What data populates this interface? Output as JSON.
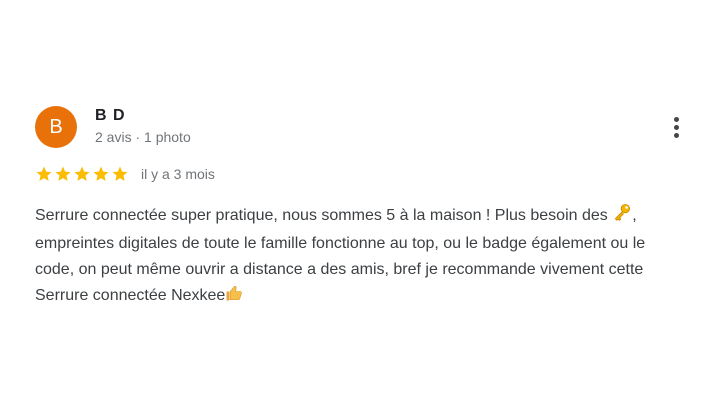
{
  "author": {
    "initial": "B",
    "name": "B D",
    "meta": "2 avis · 1 photo",
    "avatar_color": "#e8710a"
  },
  "rating": {
    "stars": 5,
    "max": 5,
    "date": "il y a 3 mois",
    "star_color": "#fbbc04"
  },
  "review": {
    "part1": "Serrure connectée super pratique, nous sommes 5 à la maison ! Plus besoin des ",
    "key_icon": "key-icon",
    "part2": ", empreintes digitales de toute le famille fonctionne au top, ou le badge également ou le code, on peut même ouvrir a distance a des amis, bref je recommande vivement cette Serrure connectée Nexkee",
    "thumb_icon": "thumbs-up-icon"
  },
  "more_icon": "more-vert-icon"
}
